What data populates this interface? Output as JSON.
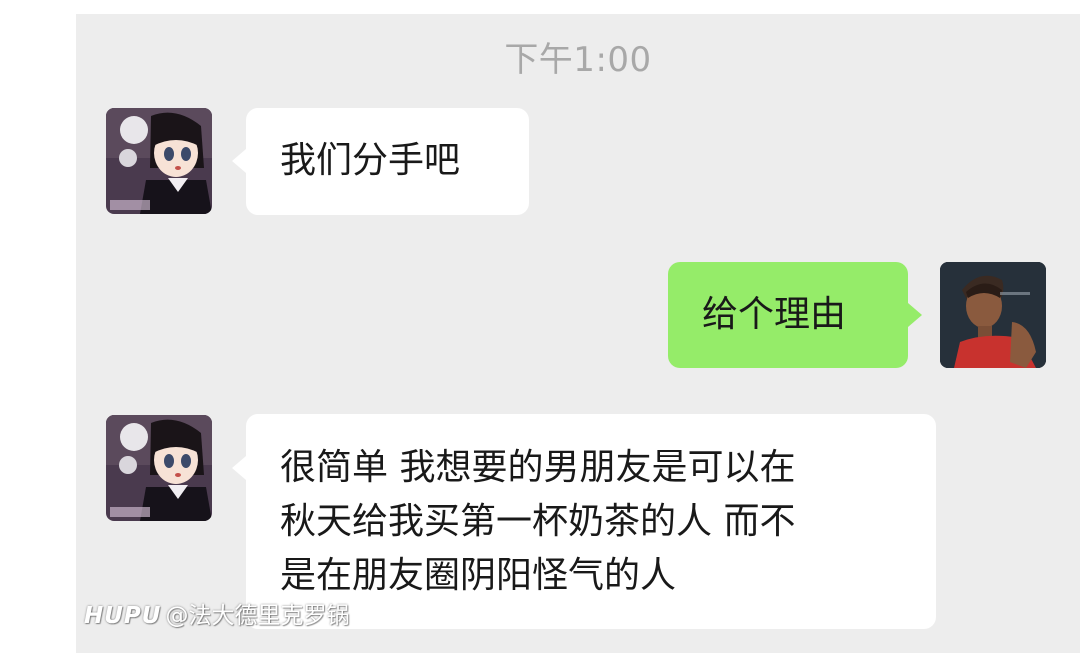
{
  "timestamp": "下午1:00",
  "messages": [
    {
      "side": "left",
      "sender": "girl-avatar",
      "text": "我们分手吧"
    },
    {
      "side": "right",
      "sender": "boy-avatar",
      "text": "给个理由"
    },
    {
      "side": "left",
      "sender": "girl-avatar",
      "lines": [
        "很简单 我想要的男朋友是可以在",
        "秋天给我买第一杯奶茶的人 而不",
        "是在朋友圈阴阳怪气的人"
      ]
    }
  ],
  "watermark": {
    "brand": "HUPU",
    "handle": "@法大德里克罗锅"
  },
  "colors": {
    "chat_bg": "#ededed",
    "incoming_bubble": "#ffffff",
    "outgoing_bubble": "#95ec69",
    "timestamp_text": "#a8a8a8",
    "message_text": "#191919"
  }
}
